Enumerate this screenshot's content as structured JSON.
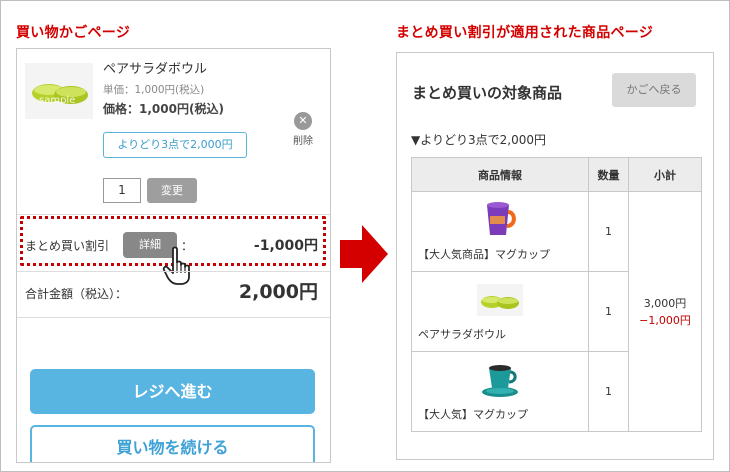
{
  "headings": {
    "left": "買い物かごページ",
    "right": "まとめ買い割引が適用された商品ページ"
  },
  "cart": {
    "product_name": "ペアサラダボウル",
    "thumbnail_watermark": "sample",
    "unit_price": "単価：1,000円(税込)",
    "price_label": "価格：",
    "price_value": "1,000円(税込)",
    "delete_label": "削除",
    "promo_badge": "よりどり3点で2,000円",
    "quantity": "1",
    "change_label": "変更",
    "discount_label": "まとめ買い割引",
    "detail_label": "詳細",
    "discount_colon": "：",
    "discount_amount": "-1,000円",
    "total_label": "合計金額（税込）：",
    "total_amount": "2,000円",
    "checkout_label": "レジへ進む",
    "continue_label": "買い物を続ける"
  },
  "target": {
    "title": "まとめ買いの対象商品",
    "back_label": "かごへ戻る",
    "promo_title": "▼よりどり3点で2,000円",
    "columns": [
      "商品情報",
      "数量",
      "小計"
    ],
    "rows": [
      {
        "name": "【大人気商品】マグカップ",
        "qty": "1",
        "icon": "purple-mug-icon"
      },
      {
        "name": "ペアサラダボウル",
        "qty": "1",
        "icon": "salad-bowl-icon"
      },
      {
        "name": "【大人気】マグカップ",
        "qty": "1",
        "icon": "teal-cup-icon"
      }
    ],
    "subtotal": "3,000円",
    "subtotal_discount": "−1,000円"
  },
  "colors": {
    "heading_red": "#d40000",
    "accent_blue": "#58b4e0",
    "discount_red": "#c40000"
  }
}
